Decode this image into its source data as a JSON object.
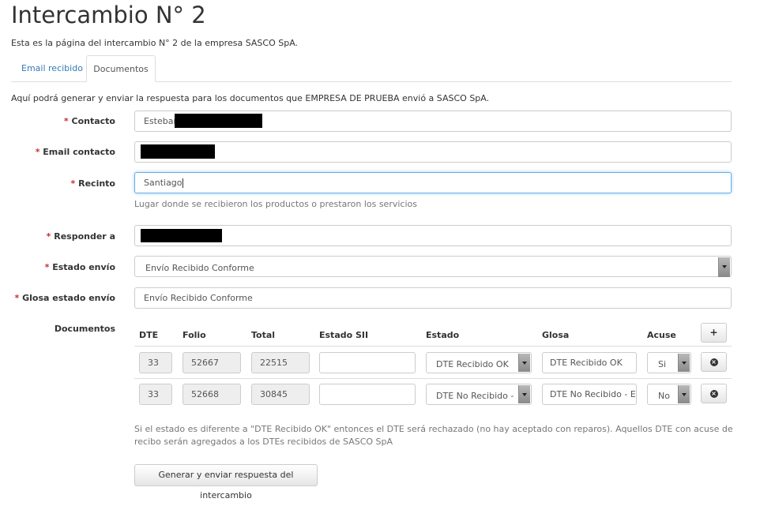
{
  "page": {
    "title": "Intercambio N° 2",
    "intro": "Esta es la página del intercambio N° 2 de la empresa SASCO SpA."
  },
  "tabs": [
    {
      "label": "Email recibido"
    },
    {
      "label": "Documentos"
    }
  ],
  "form": {
    "help": "Aquí podrá generar y enviar la respuesta para los documentos que EMPRESA DE PRUEBA envió a SASCO SpA.",
    "required_mark": "*",
    "contacto": {
      "label": "Contacto",
      "value": "Esteban"
    },
    "email": {
      "label": "Email contacto",
      "value": ""
    },
    "recinto": {
      "label": "Recinto",
      "value": "Santiago",
      "hint": "Lugar donde se recibieron los productos o prestaron los servicios"
    },
    "responder": {
      "label": "Responder a",
      "value": ""
    },
    "estado_envio": {
      "label": "Estado envío",
      "value": "Envío Recibido Conforme"
    },
    "glosa_estado": {
      "label": "Glosa estado envío",
      "value": "Envío Recibido Conforme"
    },
    "documentos_label": "Documentos"
  },
  "table": {
    "headers": [
      "DTE",
      "Folio",
      "Total",
      "Estado SII",
      "Estado",
      "Glosa",
      "Acuse"
    ],
    "add_label": "+",
    "remove_label": "×",
    "rows": [
      {
        "dte": "33",
        "folio": "52667",
        "total": "22515",
        "estado_sii": "",
        "estado": "DTE Recibido OK",
        "glosa": "DTE Recibido OK",
        "acuse": "Si"
      },
      {
        "dte": "33",
        "folio": "52668",
        "total": "30845",
        "estado_sii": "",
        "estado": "DTE No Recibido -",
        "glosa": "DTE No Recibido - E",
        "acuse": "No"
      }
    ]
  },
  "footer": {
    "note": "Si el estado es diferente a \"DTE Recibido OK\" entonces el DTE será rechazado (no hay aceptado con reparos). Aquellos DTE con acuse de recibo serán agregados a los DTEs recibidos de SASCO SpA",
    "submit_label": "Generar y enviar respuesta del intercambio"
  }
}
